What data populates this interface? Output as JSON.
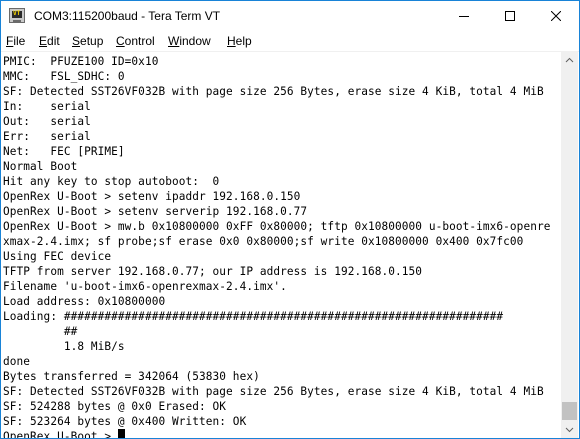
{
  "window": {
    "title": "COM3:115200baud - Tera Term VT",
    "icon": "tera-term-icon",
    "icon_text": "VT"
  },
  "menu": [
    {
      "first": "F",
      "rest": "ile"
    },
    {
      "first": "E",
      "rest": "dit"
    },
    {
      "first": "S",
      "rest": "etup"
    },
    {
      "first": "C",
      "rest": "ontrol"
    },
    {
      "first": "W",
      "rest": "indow"
    },
    {
      "first": "H",
      "rest": "elp"
    }
  ],
  "terminal": {
    "lines": [
      "PMIC:  PFUZE100 ID=0x10",
      "MMC:   FSL_SDHC: 0",
      "SF: Detected SST26VF032B with page size 256 Bytes, erase size 4 KiB, total 4 MiB",
      "In:    serial",
      "Out:   serial",
      "Err:   serial",
      "Net:   FEC [PRIME]",
      "Normal Boot",
      "Hit any key to stop autoboot:  0",
      "OpenRex U-Boot > setenv ipaddr 192.168.0.150",
      "OpenRex U-Boot > setenv serverip 192.168.0.77",
      "OpenRex U-Boot > mw.b 0x10800000 0xFF 0x80000; tftp 0x10800000 u-boot-imx6-openre",
      "xmax-2.4.imx; sf probe;sf erase 0x0 0x80000;sf write 0x10800000 0x400 0x7fc00",
      "Using FEC device",
      "TFTP from server 192.168.0.77; our IP address is 192.168.0.150",
      "Filename 'u-boot-imx6-openrexmax-2.4.imx'.",
      "Load address: 0x10800000",
      "Loading: #################################################################",
      "         ##",
      "         1.8 MiB/s",
      "done",
      "Bytes transferred = 342064 (53830 hex)",
      "SF: Detected SST26VF032B with page size 256 Bytes, erase size 4 KiB, total 4 MiB",
      "SF: 524288 bytes @ 0x0 Erased: OK",
      "SF: 523264 bytes @ 0x400 Written: OK"
    ],
    "prompt": "OpenRex U-Boot > "
  }
}
